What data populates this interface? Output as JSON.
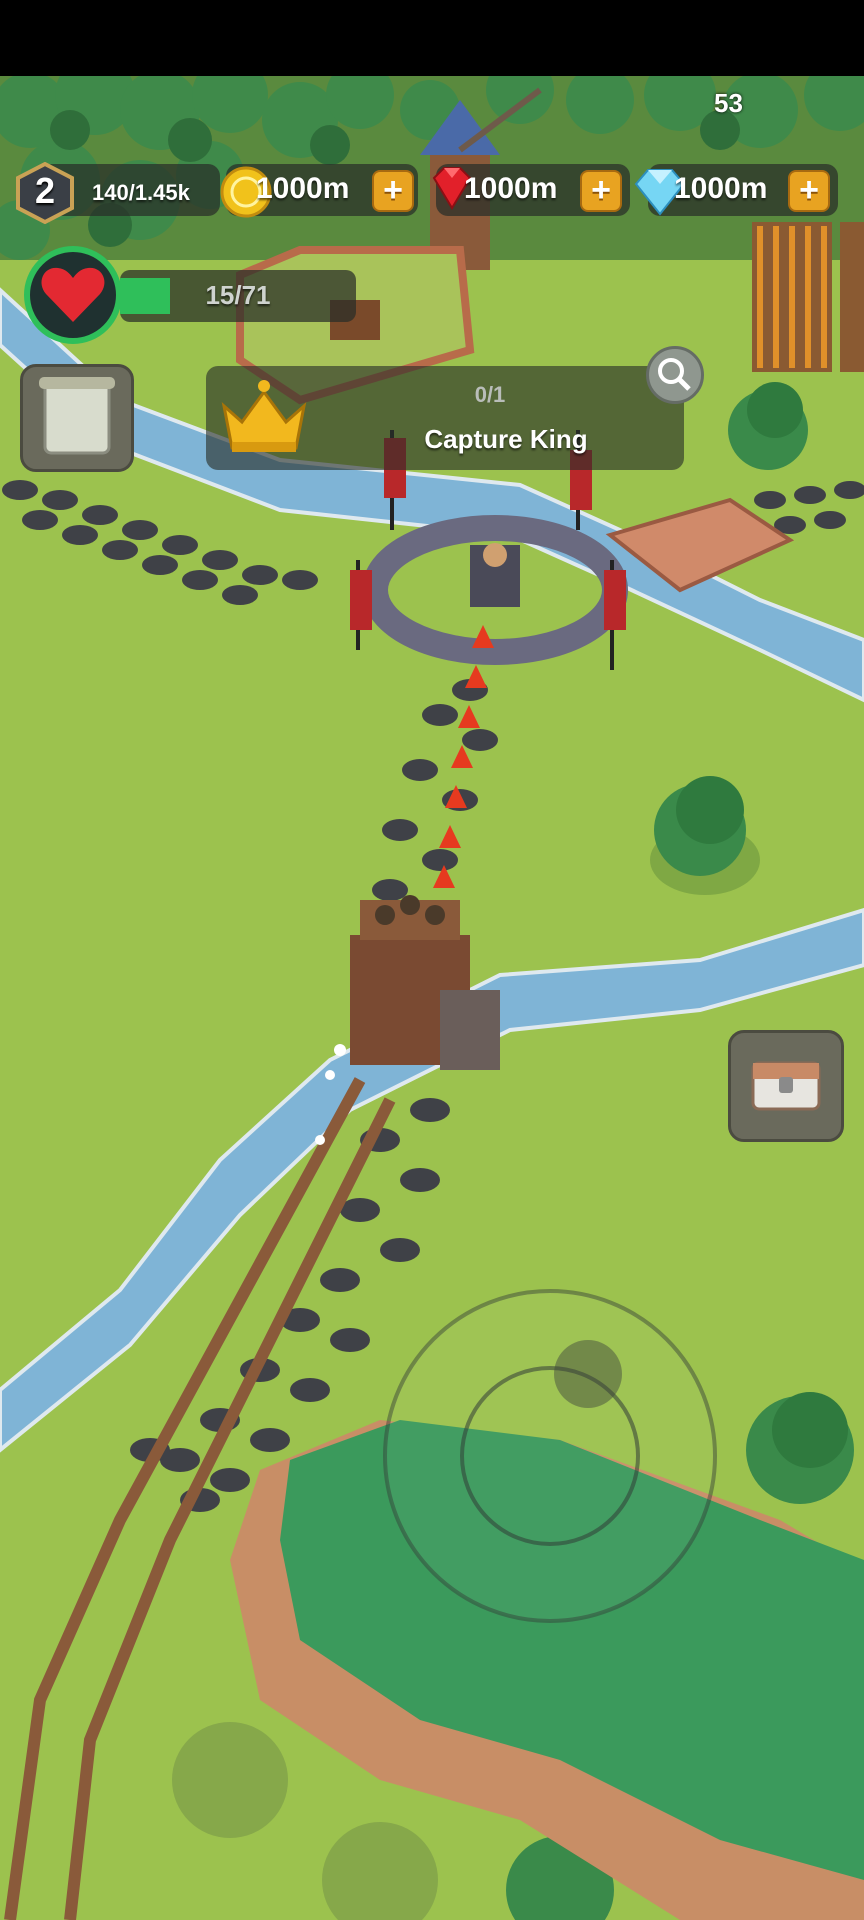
{
  "status": {
    "fps": "53"
  },
  "player": {
    "level": "2",
    "xp": "140/1.45k"
  },
  "currencies": [
    {
      "name": "gold",
      "value": "1000m",
      "icon": "gold-coin-icon"
    },
    {
      "name": "ruby",
      "value": "1000m",
      "icon": "ruby-icon"
    },
    {
      "name": "diamond",
      "value": "1000m",
      "icon": "diamond-icon"
    }
  ],
  "health": {
    "text": "15/71",
    "fraction": 0.21
  },
  "quest": {
    "progress": "0/1",
    "title": "Capture King",
    "icon": "crown-icon"
  },
  "buttons": {
    "plus": "+"
  },
  "colors": {
    "grass": "#9cc24e",
    "river": "#7fb4d6",
    "hp": "#2fbf5a",
    "accent": "#e8a321"
  }
}
